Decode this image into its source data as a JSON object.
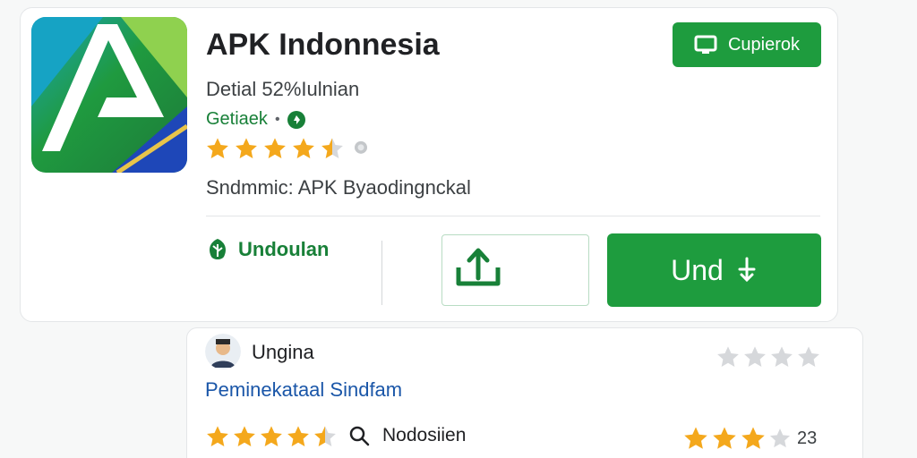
{
  "app": {
    "title": "APK Indonnesia",
    "subtitle": "Detial 52%Iulnian",
    "developer": "Getiaek",
    "dot": "•",
    "rating_stars": 4.5,
    "description": "Sndmmic: APK Byaodingnckal",
    "colors": {
      "accent": "#1e9c3e",
      "link": "#1a56a8",
      "star": "#f4a81c"
    }
  },
  "top_button": {
    "label": "Cupierok",
    "icon": "monitor-icon"
  },
  "actions": {
    "left_label": "Undoulan",
    "left_icon": "leaf-shield-icon",
    "download_icon": "upload-arrow-icon",
    "main_label": "Und",
    "main_icon": "plus-arrow-icon"
  },
  "review": {
    "reviewer": "Ungina",
    "title": "Peminekataal Sindfam",
    "grey_stars": 4,
    "review_rating": 4.5,
    "search_label": "Nodosiien",
    "right_rating": 3,
    "right_count": "23"
  }
}
